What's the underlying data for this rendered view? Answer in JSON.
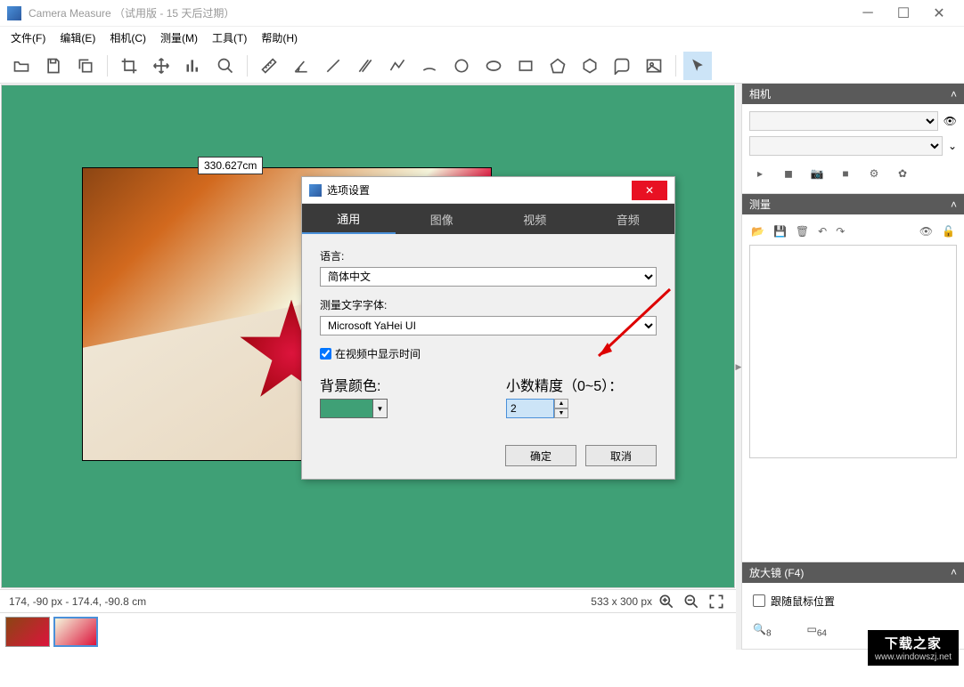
{
  "window": {
    "title": "Camera Measure （试用版 - 15 天后过期）"
  },
  "menu": {
    "file": "文件(F)",
    "edit": "编辑(E)",
    "camera": "相机(C)",
    "measure": "测量(M)",
    "tool": "工具(T)",
    "help": "帮助(H)"
  },
  "canvas": {
    "measure_label": "330.627cm"
  },
  "status": {
    "left": "174, -90 px - 174.4, -90.8 cm",
    "right": "533 x 300 px"
  },
  "panels": {
    "camera": {
      "title": "相机"
    },
    "measure": {
      "title": "测量"
    },
    "magnifier": {
      "title": "放大镜 (F4)",
      "follow": "跟随鼠标位置",
      "zoom_min": "8",
      "zoom_max": "64"
    }
  },
  "dialog": {
    "title": "选项设置",
    "tabs": {
      "general": "通用",
      "image": "图像",
      "video": "视频",
      "audio": "音频"
    },
    "language_label": "语言:",
    "language_value": "简体中文",
    "font_label": "测量文字字体:",
    "font_value": "Microsoft YaHei UI",
    "show_time": "在视频中显示时间",
    "bg_label": "背景颜色:",
    "precision_label": "小数精度（0~5）：",
    "precision_value": "2",
    "ok": "确定",
    "cancel": "取消"
  },
  "watermark": {
    "line1": "下载之家",
    "line2": "www.windowszj.net"
  }
}
